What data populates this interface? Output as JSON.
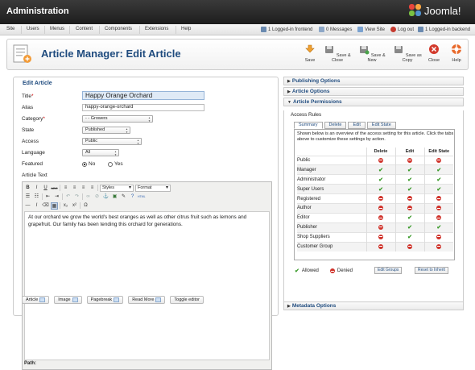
{
  "header": {
    "title": "Administration",
    "brand": "Joomla!"
  },
  "menu": {
    "items": [
      "Site",
      "Users",
      "Menus",
      "Content",
      "Components",
      "Extensions",
      "Help"
    ]
  },
  "status": {
    "logged_frontend": "1 Logged-in frontend",
    "messages": "0 Messages",
    "view_site": "View Site",
    "logout": "Log out",
    "logged_backend": "1 Logged-in backend"
  },
  "toolbar": {
    "page_title": "Article Manager: Edit Article",
    "buttons": [
      "Save",
      "Save & Close",
      "Save & New",
      "Save as Copy",
      "Close",
      "Help"
    ]
  },
  "form": {
    "legend": "Edit Article",
    "title_label": "Title",
    "title_value": "Happy Orange Orchard",
    "alias_label": "Alias",
    "alias_value": "happy-orange-orchard",
    "category_label": "Category",
    "category_value": "- - Growers",
    "state_label": "State",
    "state_value": "Published",
    "access_label": "Access",
    "access_value": "Public",
    "language_label": "Language",
    "language_value": "All",
    "featured_label": "Featured",
    "featured_no": "No",
    "featured_yes": "Yes",
    "article_text_label": "Article Text"
  },
  "editor": {
    "styles": "Styles",
    "format": "Format",
    "body": "At our orchard we grow the world's best oranges as well as other citrus fruit such as lemons and grapefruit. Our family has been tending this orchard for generations.",
    "path": "Path:",
    "buttons": [
      "Article",
      "Image",
      "Pagebreak",
      "Read More",
      "Toggle editor"
    ]
  },
  "sidebar": {
    "publishing": "Publishing Options",
    "article_options": "Article Options",
    "permissions": "Article Permissions",
    "metadata": "Metadata Options",
    "access_rules": "Access Rules",
    "tabs": [
      "Summary",
      "Delete",
      "Edit",
      "Edit State"
    ],
    "description": "Shown below is an overview of the access setting for this article. Click the tabs above to customize these settings by action.",
    "columns": [
      "Delete",
      "Edit",
      "Edit State"
    ],
    "rows": [
      {
        "group": "Public",
        "delete": "denied",
        "edit": "denied",
        "edit_state": "denied"
      },
      {
        "group": "Manager",
        "delete": "allowed",
        "edit": "allowed",
        "edit_state": "allowed"
      },
      {
        "group": "Administrator",
        "delete": "allowed",
        "edit": "allowed",
        "edit_state": "allowed"
      },
      {
        "group": "Super Users",
        "delete": "allowed",
        "edit": "allowed",
        "edit_state": "allowed"
      },
      {
        "group": "Registered",
        "delete": "denied",
        "edit": "denied",
        "edit_state": "denied"
      },
      {
        "group": "Author",
        "delete": "denied",
        "edit": "denied",
        "edit_state": "denied"
      },
      {
        "group": "Editor",
        "delete": "denied",
        "edit": "allowed",
        "edit_state": "denied"
      },
      {
        "group": "Publisher",
        "delete": "denied",
        "edit": "allowed",
        "edit_state": "allowed"
      },
      {
        "group": "Shop Suppliers",
        "delete": "denied",
        "edit": "allowed",
        "edit_state": "denied"
      },
      {
        "group": "Customer Group",
        "delete": "denied",
        "edit": "denied",
        "edit_state": "denied"
      }
    ],
    "legend_allowed": "Allowed",
    "legend_denied": "Denied",
    "edit_groups": "Edit Groups",
    "reset": "Reset to Inherit"
  }
}
